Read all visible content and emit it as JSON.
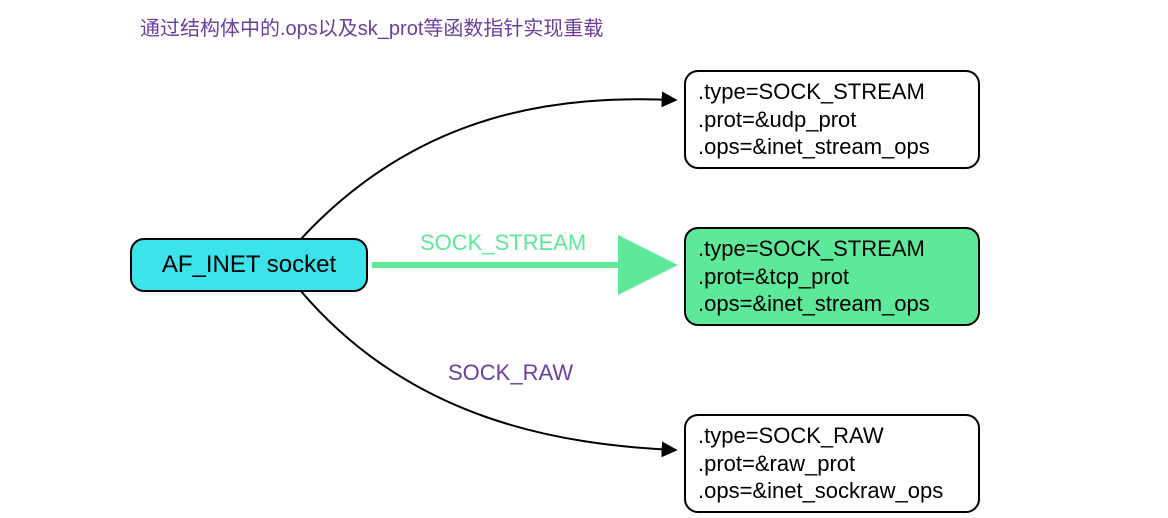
{
  "title": "通过结构体中的.ops以及sk_prot等函数指针实现重载",
  "source": {
    "label": "AF_INET socket"
  },
  "edges": {
    "top": {
      "label": ""
    },
    "middle": {
      "label": "SOCK_STREAM"
    },
    "bottom": {
      "label": "SOCK_RAW"
    }
  },
  "targets": {
    "top": {
      "type_line": ".type=SOCK_STREAM",
      "prot_line": ".prot=&udp_prot",
      "ops_line": ".ops=&inet_stream_ops"
    },
    "middle": {
      "type_line": ".type=SOCK_STREAM",
      "prot_line": ".prot=&tcp_prot",
      "ops_line": ".ops=&inet_stream_ops"
    },
    "bottom": {
      "type_line": ".type=SOCK_RAW",
      "prot_line": ".prot=&raw_prot",
      "ops_line": ".ops=&inet_sockraw_ops"
    }
  },
  "colors": {
    "purple": "#6b3fa0",
    "cyan": "#3be3ea",
    "green": "#5de89a",
    "black": "#000000"
  }
}
